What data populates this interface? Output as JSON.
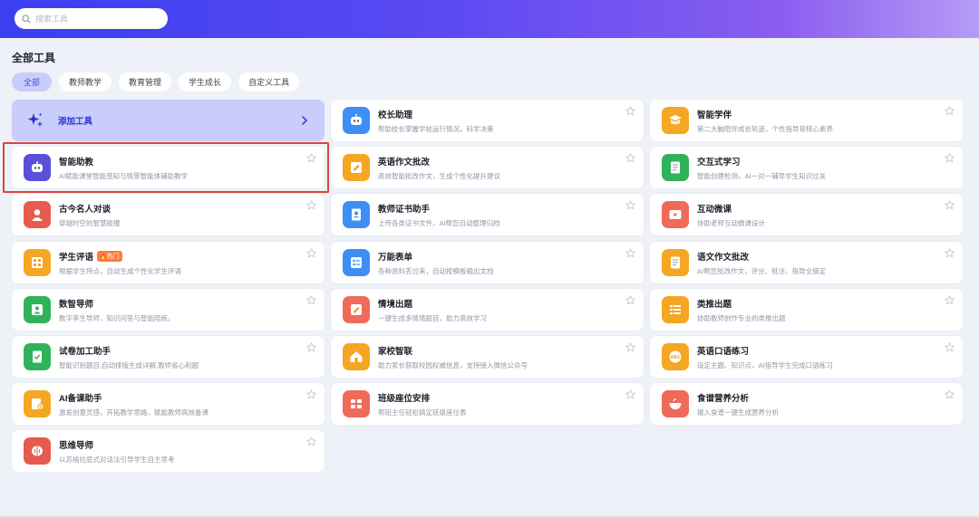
{
  "search": {
    "placeholder": "搜索工具"
  },
  "section_title": "全部工具",
  "tabs": [
    {
      "label": "全部",
      "active": true
    },
    {
      "label": "教师教学",
      "active": false
    },
    {
      "label": "教育管理",
      "active": false
    },
    {
      "label": "学生成长",
      "active": false
    },
    {
      "label": "自定义工具",
      "active": false
    }
  ],
  "add_tool": {
    "label": "添加工具",
    "icon": "sparkle-icon",
    "chevron": "chevron-right-icon"
  },
  "tools": [
    {
      "name": "校长助理",
      "desc": "帮助校长掌握学校运行情况，科学决策",
      "icon": "robot-icon",
      "color": "#3d8ff5",
      "col": 1,
      "row": 0
    },
    {
      "name": "智能学伴",
      "desc": "第二大脑陪伴成长轨迹，个性指导育核心素养",
      "icon": "book-icon",
      "color": "#f5a623",
      "col": 2,
      "row": 0
    },
    {
      "name": "智能助教",
      "desc": "AI赋能课堂智能感知与情景智能体辅助教学",
      "icon": "robot-icon",
      "color": "#5a4fd8",
      "col": 0,
      "row": 1
    },
    {
      "name": "英语作文批改",
      "desc": "高效智能批改作文，生成个性化提升建议",
      "icon": "edit-icon",
      "color": "#f5a623",
      "col": 1,
      "row": 1
    },
    {
      "name": "交互式学习",
      "desc": "智能创建检测，AI一对一辅导学生知识过关",
      "icon": "document-icon",
      "color": "#2fb35a",
      "col": 2,
      "row": 1
    },
    {
      "name": "古今名人对谈",
      "desc": "穿越时空的智慧碰撞",
      "icon": "person-icon",
      "color": "#e85a4f",
      "col": 0,
      "row": 2
    },
    {
      "name": "教师证书助手",
      "desc": "上传各类证书文件，AI帮您自动整理归档",
      "icon": "certificate-icon",
      "color": "#3d8ff5",
      "col": 1,
      "row": 2
    },
    {
      "name": "互动微课",
      "desc": "协助老师互动微课设计",
      "icon": "play-icon",
      "color": "#f06a5a",
      "col": 2,
      "row": 2
    },
    {
      "name": "学生评语",
      "desc": "根据学生特点，自动生成个性化学生评语",
      "icon": "grid-icon",
      "color": "#f5a623",
      "col": 0,
      "row": 3,
      "badge": "热门"
    },
    {
      "name": "万能表单",
      "desc": "各种资料丢过来，自动按模板输出文档",
      "icon": "form-icon",
      "color": "#3d8ff5",
      "col": 1,
      "row": 3
    },
    {
      "name": "语文作文批改",
      "desc": "AI帮您批改作文，评分、批注、指导全搞定",
      "icon": "document-icon",
      "color": "#f5a623",
      "col": 2,
      "row": 3
    },
    {
      "name": "数智导师",
      "desc": "数字孪生导师，知识问答与智能陪练。",
      "icon": "people-icon",
      "color": "#2fb35a",
      "col": 0,
      "row": 4
    },
    {
      "name": "情境出题",
      "desc": "一键生成多情境题目，助力高效学习",
      "icon": "edit-icon",
      "color": "#f06a5a",
      "col": 1,
      "row": 4
    },
    {
      "name": "类推出题",
      "desc": "协助教师创作专业的类推出题",
      "icon": "list-icon",
      "color": "#f5a623",
      "col": 2,
      "row": 4
    },
    {
      "name": "试卷加工助手",
      "desc": "智能识别题目,自动排版生成详解,教师省心利题",
      "icon": "paper-icon",
      "color": "#2fb35a",
      "col": 0,
      "row": 5
    },
    {
      "name": "家校智联",
      "desc": "助力家长获取校园权威信息，支持接入微信公众号",
      "icon": "home-icon",
      "color": "#f5a623",
      "col": 1,
      "row": 5
    },
    {
      "name": "英语口语练习",
      "desc": "设定主题、知识点，AI指导学生完成口语练习",
      "icon": "abc-icon",
      "color": "#f5a623",
      "col": 2,
      "row": 5
    },
    {
      "name": "AI备课助手",
      "desc": "激发创意灵感，开拓教学思路，赋能教师高效备课",
      "icon": "book-plus-icon",
      "color": "#f5a623",
      "col": 0,
      "row": 6
    },
    {
      "name": "班级座位安排",
      "desc": "帮班主任轻松搞定班级座位表",
      "icon": "seats-icon",
      "color": "#f06a5a",
      "col": 1,
      "row": 6
    },
    {
      "name": "食谱营养分析",
      "desc": "输入食谱一键生成营养分析",
      "icon": "bowl-icon",
      "color": "#f06a5a",
      "col": 2,
      "row": 6
    },
    {
      "name": "思维导师",
      "desc": "以苏格拉底式对话法引导学生自主思考",
      "icon": "brain-icon",
      "color": "#e85a4f",
      "col": 0,
      "row": 7
    }
  ]
}
